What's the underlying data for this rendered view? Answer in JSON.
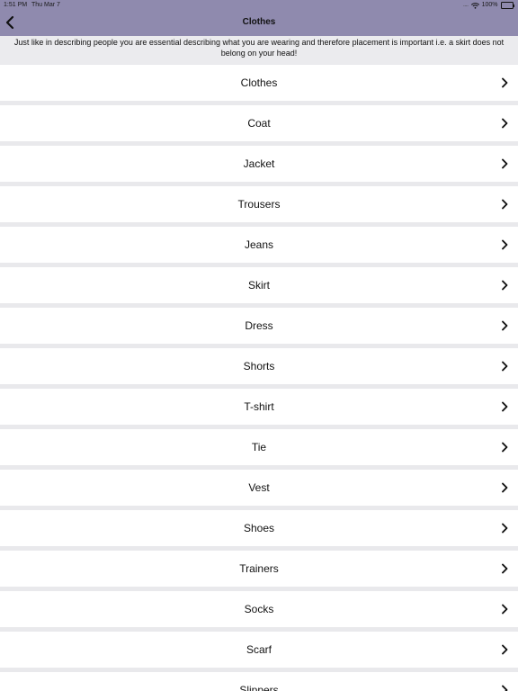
{
  "status_bar": {
    "time": "1:51 PM",
    "date": "Thu Mar 7",
    "signal": "....",
    "battery": "100%"
  },
  "nav": {
    "title": "Clothes",
    "back_icon": "chevron-left-icon"
  },
  "intro": "Just like in describing people you are essential describing what you are wearing and therefore placement is important i.e. a skirt does not belong on your head!",
  "items": [
    {
      "label": "Clothes"
    },
    {
      "label": "Coat"
    },
    {
      "label": "Jacket"
    },
    {
      "label": "Trousers"
    },
    {
      "label": "Jeans"
    },
    {
      "label": "Skirt"
    },
    {
      "label": "Dress"
    },
    {
      "label": "Shorts"
    },
    {
      "label": "T-shirt"
    },
    {
      "label": "Tie"
    },
    {
      "label": "Vest"
    },
    {
      "label": "Shoes"
    },
    {
      "label": "Trainers"
    },
    {
      "label": "Socks"
    },
    {
      "label": "Scarf"
    },
    {
      "label": "Slippers"
    }
  ],
  "colors": {
    "header": "#8f8aae",
    "background": "#e9e9ec",
    "row": "#ffffff",
    "text": "#111111"
  }
}
